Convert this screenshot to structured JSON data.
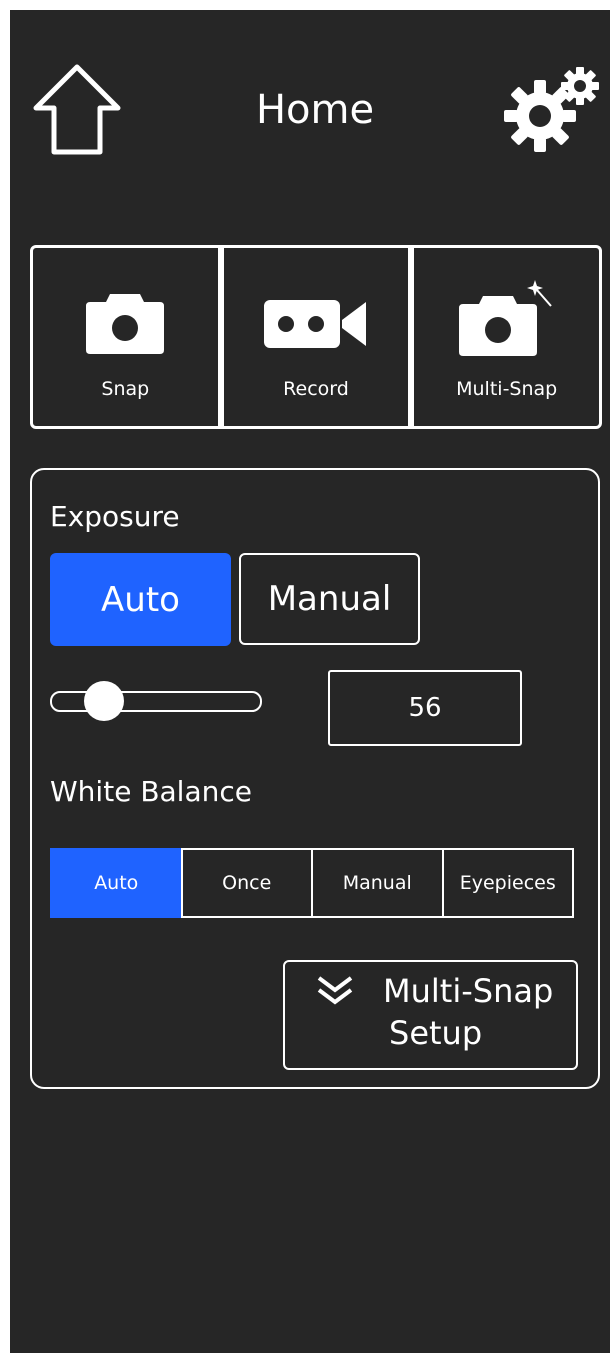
{
  "header": {
    "title": "Home",
    "home_icon": "home-icon",
    "settings_icon": "gears-icon"
  },
  "capture": {
    "buttons": [
      {
        "label": "Snap",
        "icon": "camera-icon"
      },
      {
        "label": "Record",
        "icon": "video-camera-icon"
      },
      {
        "label": "Multi-Snap",
        "icon": "camera-sparkle-icon"
      }
    ]
  },
  "exposure": {
    "label": "Exposure",
    "modes": [
      "Auto",
      "Manual"
    ],
    "active_mode": "Auto",
    "slider_value_fraction": 0.2,
    "value": "56"
  },
  "white_balance": {
    "label": "White Balance",
    "modes": [
      "Auto",
      "Once",
      "Manual",
      "Eyepieces"
    ],
    "active_mode": "Auto"
  },
  "multi_snap_setup": {
    "line1": "Multi-Snap",
    "line2": "Setup",
    "icon": "double-chevron-down-icon"
  },
  "colors": {
    "background": "#262626",
    "accent": "#1f63ff",
    "foreground": "#ffffff"
  }
}
